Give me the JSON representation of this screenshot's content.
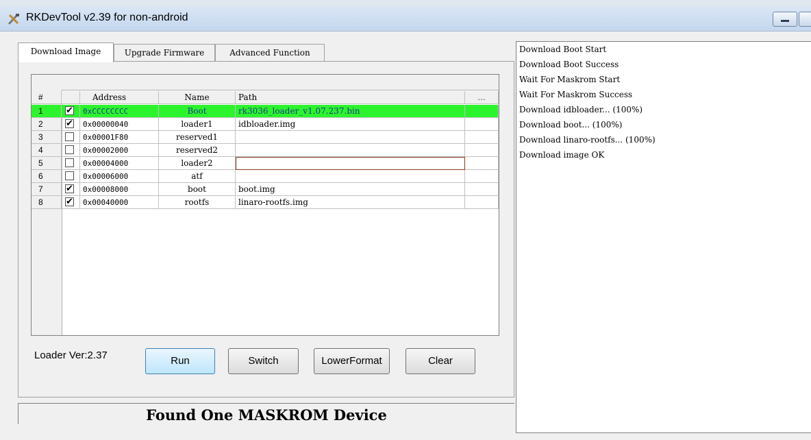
{
  "window": {
    "title": "RKDevTool v2.39 for non-android"
  },
  "tabs": [
    {
      "label": "Download Image",
      "active": true
    },
    {
      "label": "Upgrade Firmware",
      "active": false
    },
    {
      "label": "Advanced Function",
      "active": false
    }
  ],
  "table": {
    "headers": {
      "num": "#",
      "address": "Address",
      "name": "Name",
      "path": "Path",
      "more": "..."
    },
    "rows": [
      {
        "num": "1",
        "checked": "✔",
        "address": "0xCCCCCCCC",
        "name": "Boot",
        "path": "rk3036_loader_v1.07.237.bin"
      },
      {
        "num": "2",
        "checked": "✔",
        "address": "0x00000040",
        "name": "loader1",
        "path": "idbloader.img"
      },
      {
        "num": "3",
        "checked": "",
        "address": "0x00001F80",
        "name": "reserved1",
        "path": ""
      },
      {
        "num": "4",
        "checked": "",
        "address": "0x00002000",
        "name": "reserved2",
        "path": ""
      },
      {
        "num": "5",
        "checked": "",
        "address": "0x00004000",
        "name": "loader2",
        "path": ""
      },
      {
        "num": "6",
        "checked": "",
        "address": "0x00006000",
        "name": "atf",
        "path": ""
      },
      {
        "num": "7",
        "checked": "✔",
        "address": "0x00008000",
        "name": "boot",
        "path": "boot.img"
      },
      {
        "num": "8",
        "checked": "✔",
        "address": "0x00040000",
        "name": "rootfs",
        "path": "linaro-rootfs.img"
      }
    ]
  },
  "loader_version": "Loader Ver:2.37",
  "buttons": {
    "run": "Run",
    "switch": "Switch",
    "lower_format": "LowerFormat",
    "clear": "Clear"
  },
  "status": "Found One MASKROM Device",
  "log": [
    "Download Boot Start",
    "Download Boot Success",
    "Wait For Maskrom Start",
    "Wait For Maskrom Success",
    "Download idbloader... (100%)",
    "Download boot... (100%)",
    "Download linaro-rootfs... (100%)",
    "Download image OK"
  ]
}
